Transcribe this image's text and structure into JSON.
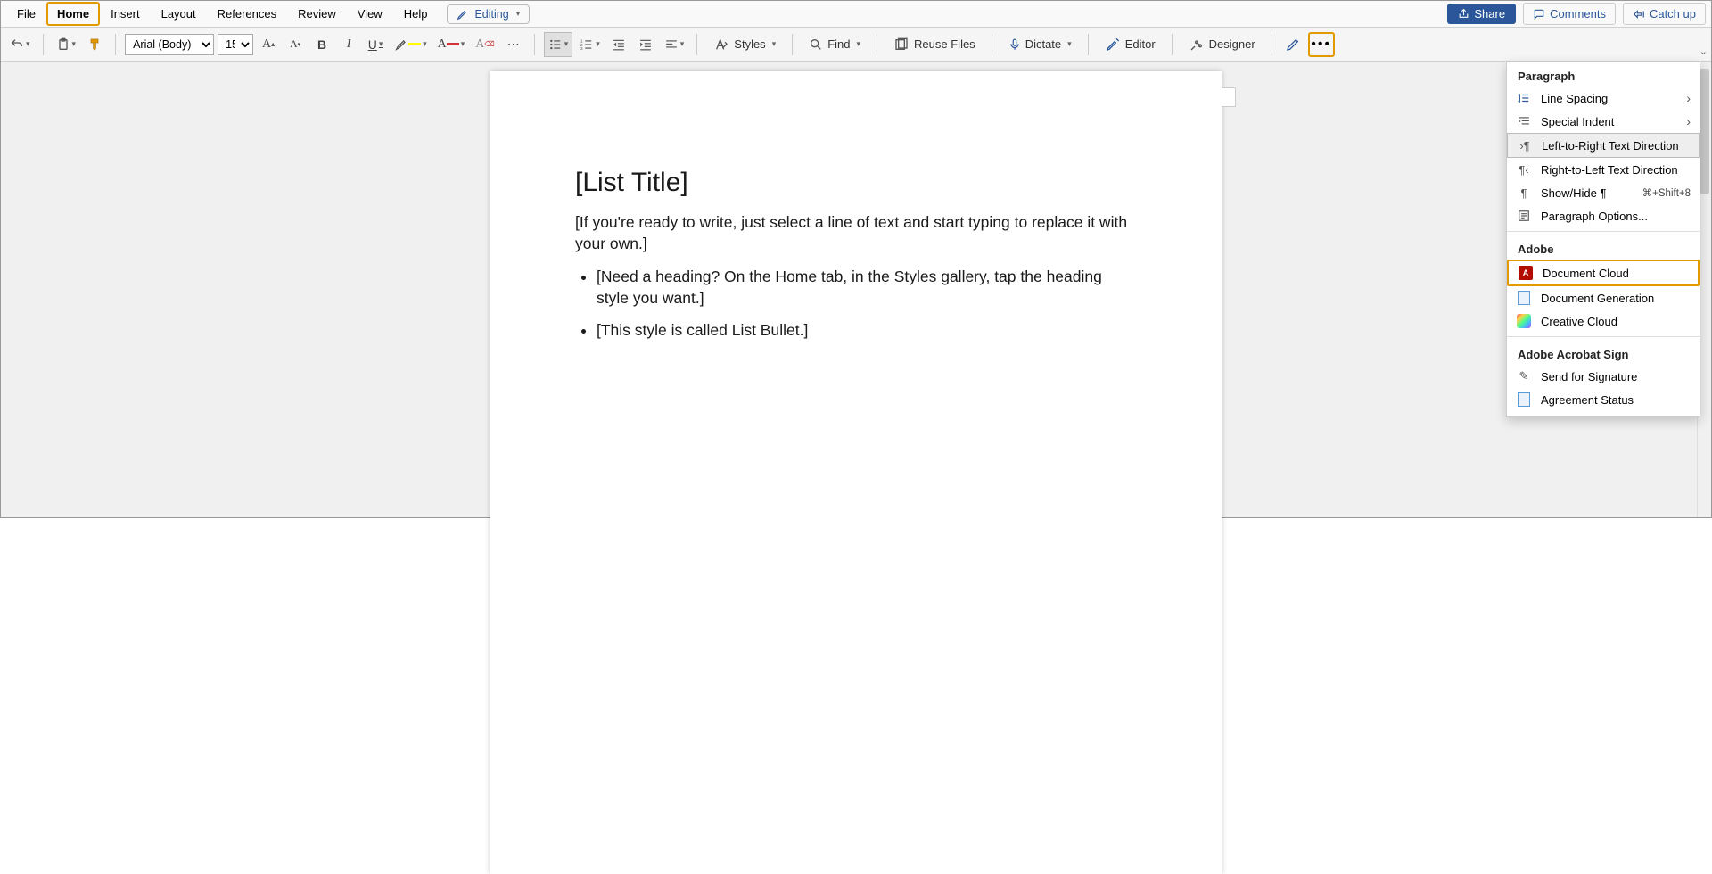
{
  "menu": {
    "file": "File",
    "home": "Home",
    "insert": "Insert",
    "layout": "Layout",
    "references": "References",
    "review": "Review",
    "view": "View",
    "help": "Help",
    "editing": "Editing"
  },
  "topright": {
    "share": "Share",
    "comments": "Comments",
    "catchup": "Catch up"
  },
  "ribbon": {
    "font_name": "Arial (Body)",
    "font_size": "15",
    "styles": "Styles",
    "find": "Find",
    "reuse": "Reuse Files",
    "dictate": "Dictate",
    "editor": "Editor",
    "designer": "Designer"
  },
  "doc": {
    "title": "[List Title]",
    "intro": "[If you're ready to write, just select a line of text and start typing to replace it with your own.]",
    "bullets": [
      "[Need a heading? On the Home tab, in the Styles gallery, tap the heading style you want.]",
      "[This style is called List Bullet.]"
    ]
  },
  "overflow": {
    "group_paragraph": "Paragraph",
    "line_spacing": "Line Spacing",
    "special_indent": "Special Indent",
    "ltr": "Left-to-Right Text Direction",
    "rtl": "Right-to-Left Text Direction",
    "show_hide": "Show/Hide ¶",
    "show_hide_shortcut": "⌘+Shift+8",
    "paragraph_options": "Paragraph Options...",
    "group_adobe": "Adobe",
    "document_cloud": "Document Cloud",
    "document_generation": "Document Generation",
    "creative_cloud": "Creative Cloud",
    "group_sign": "Adobe Acrobat Sign",
    "send_for_signature": "Send for Signature",
    "agreement_status": "Agreement Status"
  }
}
